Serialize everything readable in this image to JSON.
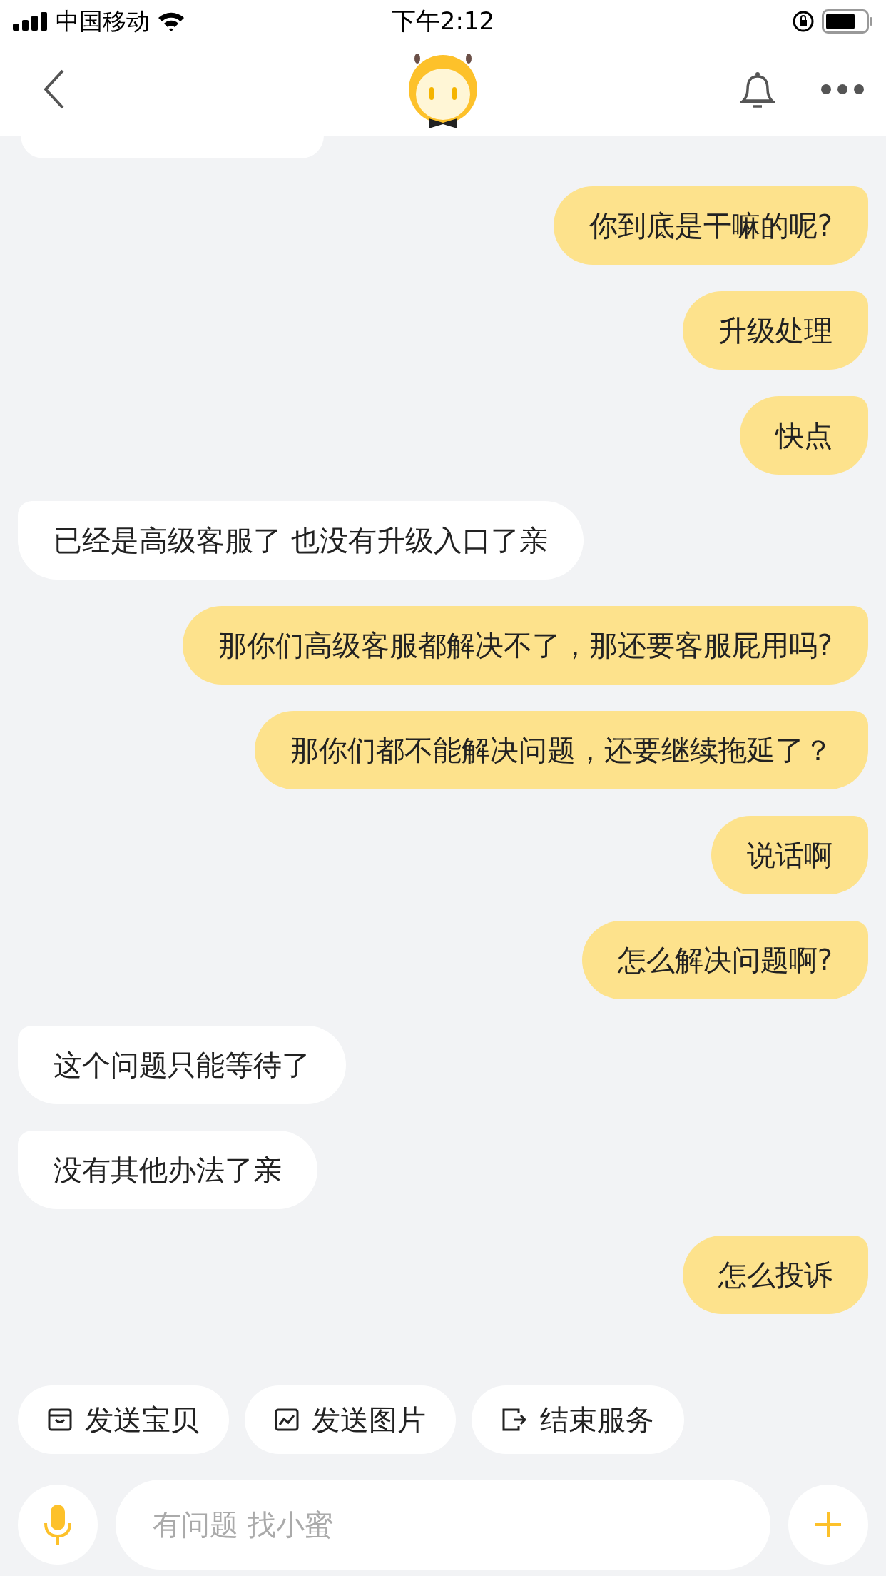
{
  "status_bar": {
    "carrier": "中国移动",
    "time": "下午2:12"
  },
  "messages": [
    {
      "kind": "sent",
      "text": "你到底是干嘛的呢?"
    },
    {
      "kind": "sent",
      "text": "升级处理"
    },
    {
      "kind": "sent",
      "text": "快点"
    },
    {
      "kind": "received",
      "text": "已经是高级客服了 也没有升级入口了亲"
    },
    {
      "kind": "sent",
      "text": "那你们高级客服都解决不了，那还要客服屁用吗?"
    },
    {
      "kind": "sent",
      "text": "那你们都不能解决问题，还要继续拖延了？"
    },
    {
      "kind": "sent",
      "text": "说话啊"
    },
    {
      "kind": "sent",
      "text": "怎么解决问题啊?"
    },
    {
      "kind": "received",
      "text": "这个问题只能等待了"
    },
    {
      "kind": "received",
      "text": "没有其他办法了亲"
    },
    {
      "kind": "sent",
      "text": "怎么投诉"
    }
  ],
  "quick_actions": [
    {
      "kind": "item",
      "label": "发送宝贝"
    },
    {
      "kind": "image",
      "label": "发送图片"
    },
    {
      "kind": "exit",
      "label": "结束服务"
    }
  ],
  "input": {
    "placeholder": "有问题 找小蜜"
  }
}
